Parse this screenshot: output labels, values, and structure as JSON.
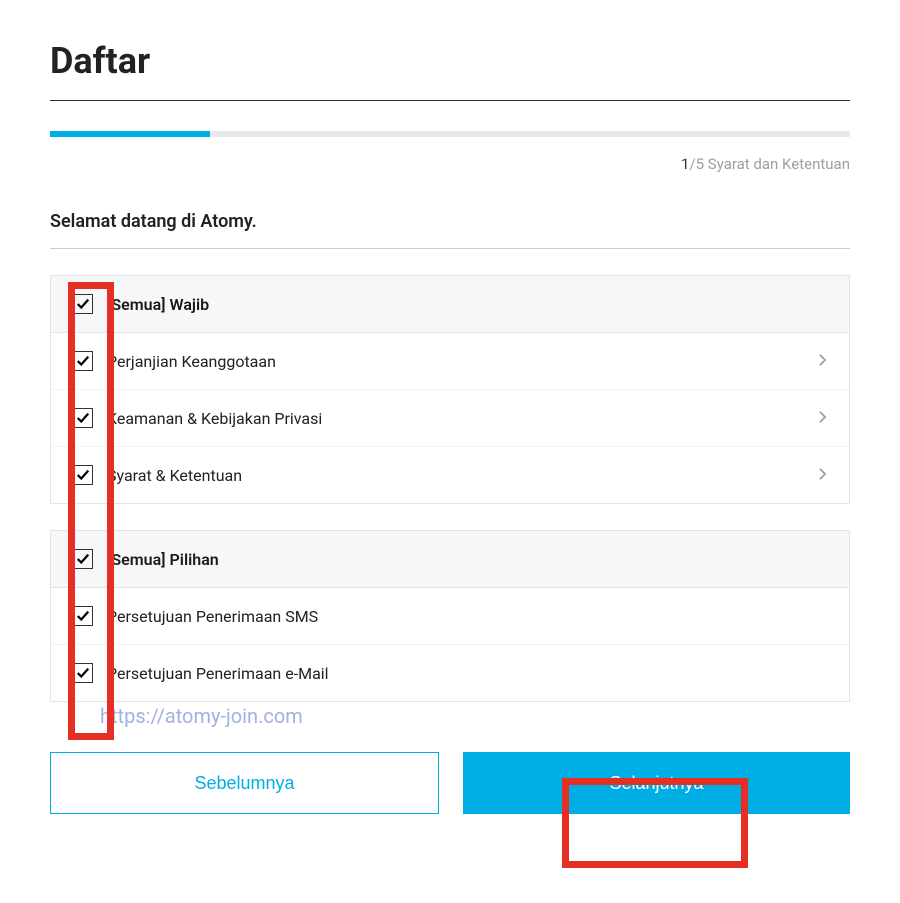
{
  "title": "Daftar",
  "progress": {
    "current": "1",
    "total": "/5",
    "step_label": " Syarat dan Ketentuan"
  },
  "welcome": "Selamat datang di Atomy.",
  "section_required": {
    "head": "[Semua] Wajib",
    "items": [
      {
        "label": "Perjanjian Keanggotaan"
      },
      {
        "label": "Keamanan & Kebijakan Privasi"
      },
      {
        "label": "Syarat & Ketentuan"
      }
    ]
  },
  "section_optional": {
    "head": "[Semua] Pilihan",
    "items": [
      {
        "label": "Persetujuan Penerimaan SMS"
      },
      {
        "label": "Persetujuan Penerimaan e-Mail"
      }
    ]
  },
  "watermark": "https://atomy-join.com",
  "buttons": {
    "prev": "Sebelumnya",
    "next": "Selanjutnya"
  }
}
